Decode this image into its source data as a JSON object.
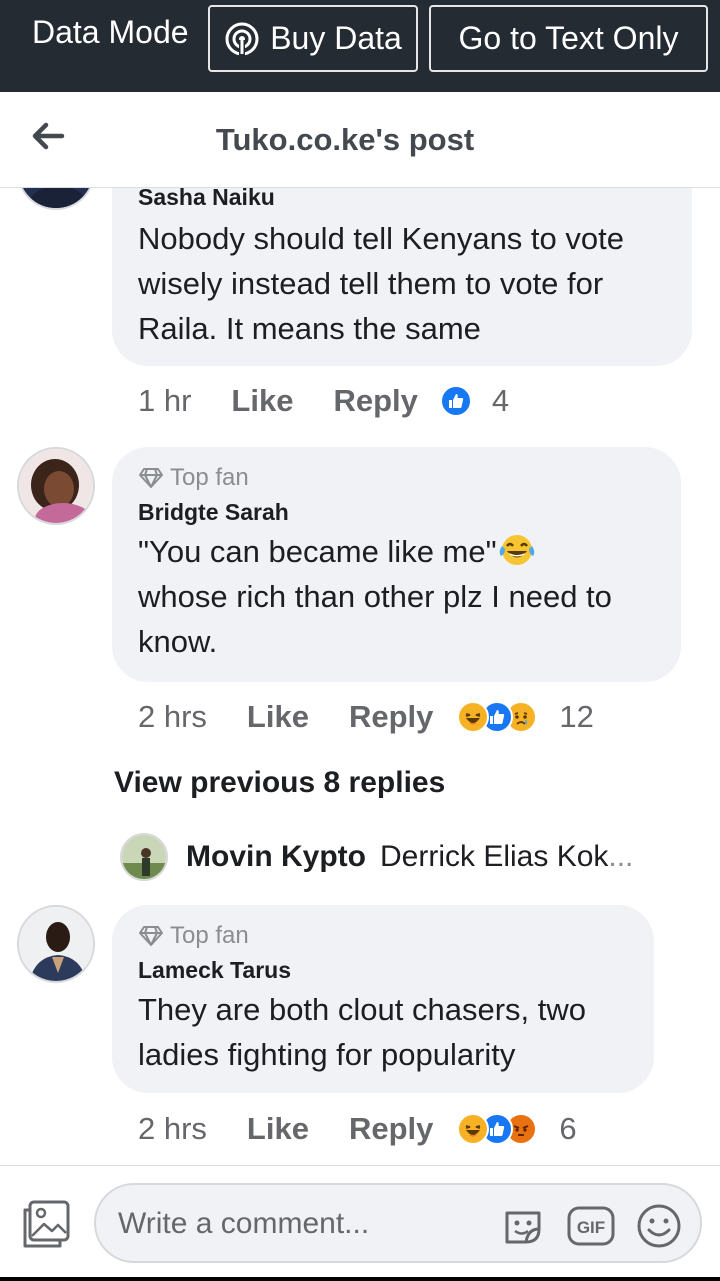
{
  "topbar": {
    "data_mode_label": "Data Mode",
    "buy_data_label": "Buy Data",
    "text_only_label": "Go to Text Only"
  },
  "header": {
    "title": "Tuko.co.ke's post"
  },
  "comments": [
    {
      "author": "Sasha Naiku",
      "text": "Nobody should tell Kenyans to vote wisely instead tell them to vote for Raila. It means the same",
      "time": "1 hr",
      "like_label": "Like",
      "reply_label": "Reply",
      "reaction_count": "4",
      "reactions": [
        "like-reaction-icon"
      ]
    },
    {
      "badge": "Top fan",
      "author": "Bridgte Sarah",
      "text_line1": "\"You can became like me\"",
      "text_rest": "whose rich than other plz I need to know.",
      "time": "2 hrs",
      "like_label": "Like",
      "reply_label": "Reply",
      "reaction_count": "12",
      "reactions": [
        "haha-reaction-icon",
        "like-reaction-icon",
        "sad-reaction-icon"
      ]
    },
    {
      "badge": "Top fan",
      "author": "Lameck Tarus",
      "text": "They are both clout chasers, two ladies fighting for popularity",
      "time": "2 hrs",
      "like_label": "Like",
      "reply_label": "Reply",
      "reaction_count": "6",
      "reactions": [
        "haha-reaction-icon",
        "like-reaction-icon",
        "angry-reaction-icon"
      ]
    }
  ],
  "view_previous": "View previous 8 replies",
  "reply_preview": {
    "author": "Movin Kypto",
    "text": "Derrick Elias Kok",
    "ellipsis": "..."
  },
  "composer": {
    "placeholder": "Write a comment..."
  },
  "colors": {
    "topbar_bg": "#252b33",
    "bubble_bg": "#f0f2f5",
    "like_blue": "#1877f2",
    "haha_yellow": "#f7b125",
    "angry_orange": "#e9710f"
  }
}
